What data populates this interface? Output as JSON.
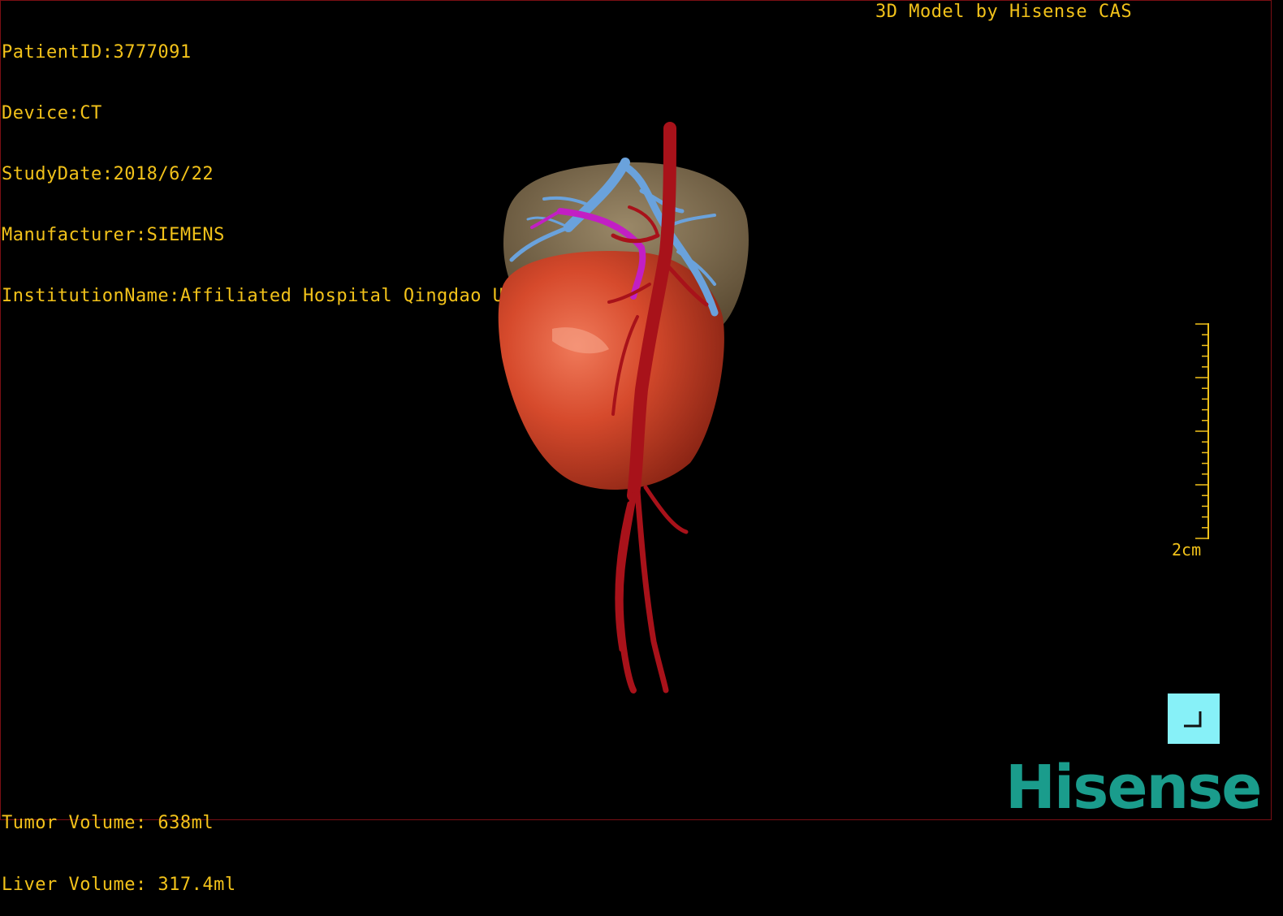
{
  "overlay": {
    "patient_id": "PatientID:3777091",
    "device": "Device:CT",
    "study_date": "StudyDate:2018/6/22",
    "manufacturer": "Manufacturer:SIEMENS",
    "institution": "InstitutionName:Affiliated Hospital Qingdao University-C",
    "vendor": "3D Model by Hisense CAS",
    "tumor_volume": "Tumor Volume: 638ml",
    "liver_volume": "Liver Volume: 317.4ml"
  },
  "scale": {
    "label": "2cm"
  },
  "logo": {
    "text": "Hisense"
  },
  "corner_button": {
    "icon": "corner-bracket-icon"
  },
  "colors": {
    "overlay_text": "#f2c21a",
    "tumor": "#d64a2c",
    "liver": "#7a6a4e",
    "portal_vein": "#6aa2dc",
    "hepatic_artery": "#a8121a",
    "magenta_vessel": "#c21fc4",
    "logo": "#1a9c8c",
    "button": "#87f1f8"
  }
}
